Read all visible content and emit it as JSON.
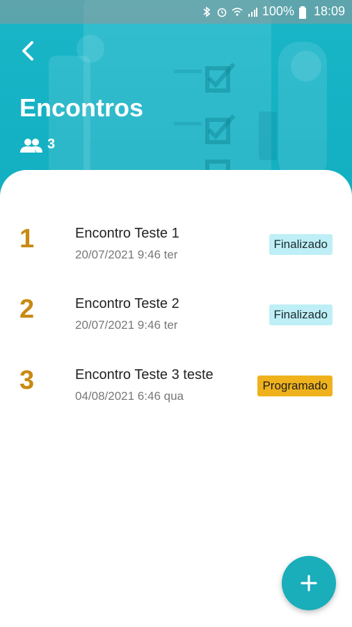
{
  "status_bar": {
    "battery": "100%",
    "time": "18:09"
  },
  "header": {
    "title": "Encontros",
    "members_count": "3"
  },
  "meetings": [
    {
      "number": "1",
      "name": "Encontro Teste 1",
      "datetime": "20/07/2021 9:46 ter",
      "status": "Finalizado"
    },
    {
      "number": "2",
      "name": "Encontro Teste 2",
      "datetime": "20/07/2021 9:46 ter",
      "status": "Finalizado"
    },
    {
      "number": "3",
      "name": "Encontro Teste 3 teste",
      "datetime": "04/08/2021 6:46 qua",
      "status": "Programado"
    }
  ],
  "colors": {
    "header_teal": "#19b6c8",
    "number_gold": "#c98a12",
    "badge_finalizado": "#bfeff6",
    "badge_programado": "#efb21d",
    "fab": "#19aeba"
  },
  "icons": {
    "back": "arrow-back-icon",
    "members": "group-icon",
    "add": "plus-icon"
  }
}
